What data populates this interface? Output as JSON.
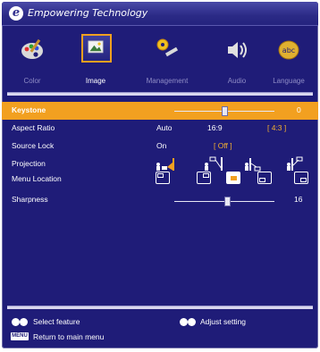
{
  "header": {
    "brand_letter": "e",
    "brand_text": "Empowering Technology"
  },
  "tabs": [
    {
      "label": "Color",
      "icon": "palette-icon"
    },
    {
      "label": "Image",
      "icon": "picture-icon"
    },
    {
      "label": "Management",
      "icon": "tools-icon"
    },
    {
      "label": "Audio",
      "icon": "speaker-icon"
    },
    {
      "label": "Language",
      "icon": "globe-abc-icon"
    }
  ],
  "active_tab": "Image",
  "settings": {
    "keystone": {
      "label": "Keystone",
      "value": "0",
      "level": 0.5
    },
    "aspect_ratio": {
      "label": "Aspect Ratio",
      "options": [
        "Auto",
        "16:9",
        "[ 4:3 ]"
      ],
      "selected": "[ 4:3 ]"
    },
    "source_lock": {
      "label": "Source Lock",
      "options": [
        "On",
        "[ Off ]"
      ],
      "selected": "[ Off ]"
    },
    "projection": {
      "label": "Projection"
    },
    "menu_location": {
      "label": "Menu Location"
    },
    "sharpness": {
      "label": "Sharpness",
      "value": "16",
      "level": 0.53
    }
  },
  "footer": {
    "select_feature": "Select feature",
    "adjust_setting": "Adjust setting",
    "menu_key": "MENU",
    "return_to_main": "Return to main menu"
  },
  "colors": {
    "background": "#1f1c78",
    "highlight": "#f2a020",
    "text": "#ffffff",
    "inactive_label": "#8f8cc6"
  }
}
